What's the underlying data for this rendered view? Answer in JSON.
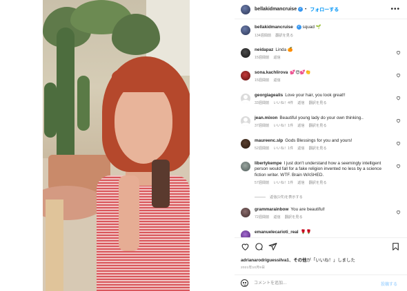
{
  "header": {
    "username": "bellakidmancruise",
    "follow_label": "フォローする",
    "separator": "•",
    "verified_glyph": "✓",
    "more_label": "•••"
  },
  "caption": {
    "username": "bellakidmancruise",
    "text": "squad 🌱",
    "time": "134週間前",
    "translate": "翻訳を見る"
  },
  "comments": [
    {
      "username": "neidapaz",
      "text": "Linda 🍊",
      "meta": [
        "15週間前",
        "返信"
      ]
    },
    {
      "username": "sona.kachlirova",
      "text": "💕😍💕👏",
      "meta": [
        "15週間前",
        "返信"
      ]
    },
    {
      "username": "georgiagealis",
      "text": "Love your hair, you look great!!",
      "meta": [
        "33週間前",
        "いいね！4件",
        "返信",
        "翻訳を見る"
      ]
    },
    {
      "username": "jean.mixon",
      "text": "Beautiful young lady do your own thinking..",
      "meta": [
        "37週間前",
        "いいね！1件",
        "返信",
        "翻訳を見る"
      ]
    },
    {
      "username": "maureenc.slp",
      "text": "Gods Blessings for you and yours!",
      "meta": [
        "52週間前",
        "いいね！1件",
        "返信",
        "翻訳を見る"
      ]
    },
    {
      "username": "libertykempe",
      "text": "I just don't understand how a seemingly intelligent person would fall for a fake religion invented no less by a science fiction writer. WTF. Brain WASHED.",
      "meta": [
        "57週間前",
        "いいね！1件",
        "返信",
        "翻訳を見る"
      ]
    },
    {
      "username": "grammarainbow",
      "text": "You are beautiful!",
      "meta": [
        "72週間前",
        "返信",
        "翻訳を見る"
      ]
    },
    {
      "username": "emanuelecarioti_real",
      "text": "🌹🌹",
      "meta": []
    }
  ],
  "replies_label": "返信(1件)を表示する",
  "likes": {
    "user": "adrianarodriguessilva1",
    "and": "、",
    "others": "その他",
    "suffix": "が「いいね！」しました"
  },
  "date": "2021年10月9日",
  "add_comment": {
    "placeholder": "コメントを追加...",
    "post_label": "投稿する"
  },
  "colors": {
    "link": "#0095f6",
    "verified": "#3897f0",
    "muted": "#8e8e8e",
    "text": "#262626"
  }
}
